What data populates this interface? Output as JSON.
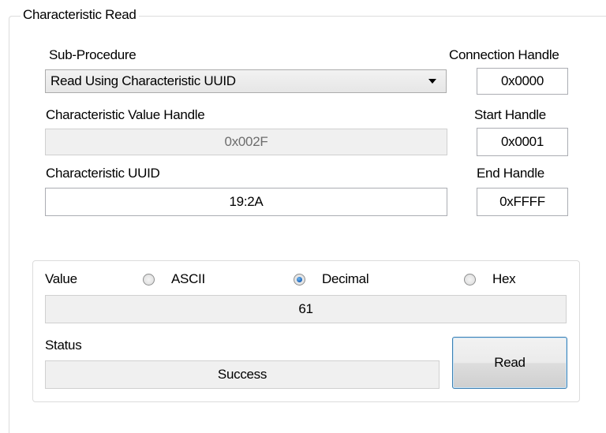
{
  "group": {
    "title": "Characteristic Read"
  },
  "sub_procedure": {
    "label": "Sub-Procedure",
    "selected": "Read Using Characteristic UUID"
  },
  "connection_handle": {
    "label": "Connection Handle",
    "value": "0x0000"
  },
  "characteristic_value_handle": {
    "label": "Characteristic Value Handle",
    "value": "0x002F"
  },
  "start_handle": {
    "label": "Start Handle",
    "value": "0x0001"
  },
  "characteristic_uuid": {
    "label": "Characteristic UUID",
    "value": "19:2A"
  },
  "end_handle": {
    "label": "End Handle",
    "value": "0xFFFF"
  },
  "value_section": {
    "label": "Value",
    "formats": [
      {
        "label": "ASCII",
        "checked": false
      },
      {
        "label": "Decimal",
        "checked": true
      },
      {
        "label": "Hex",
        "checked": false
      }
    ],
    "value": "61"
  },
  "status": {
    "label": "Status",
    "value": "Success"
  },
  "read_button": {
    "label": "Read"
  }
}
